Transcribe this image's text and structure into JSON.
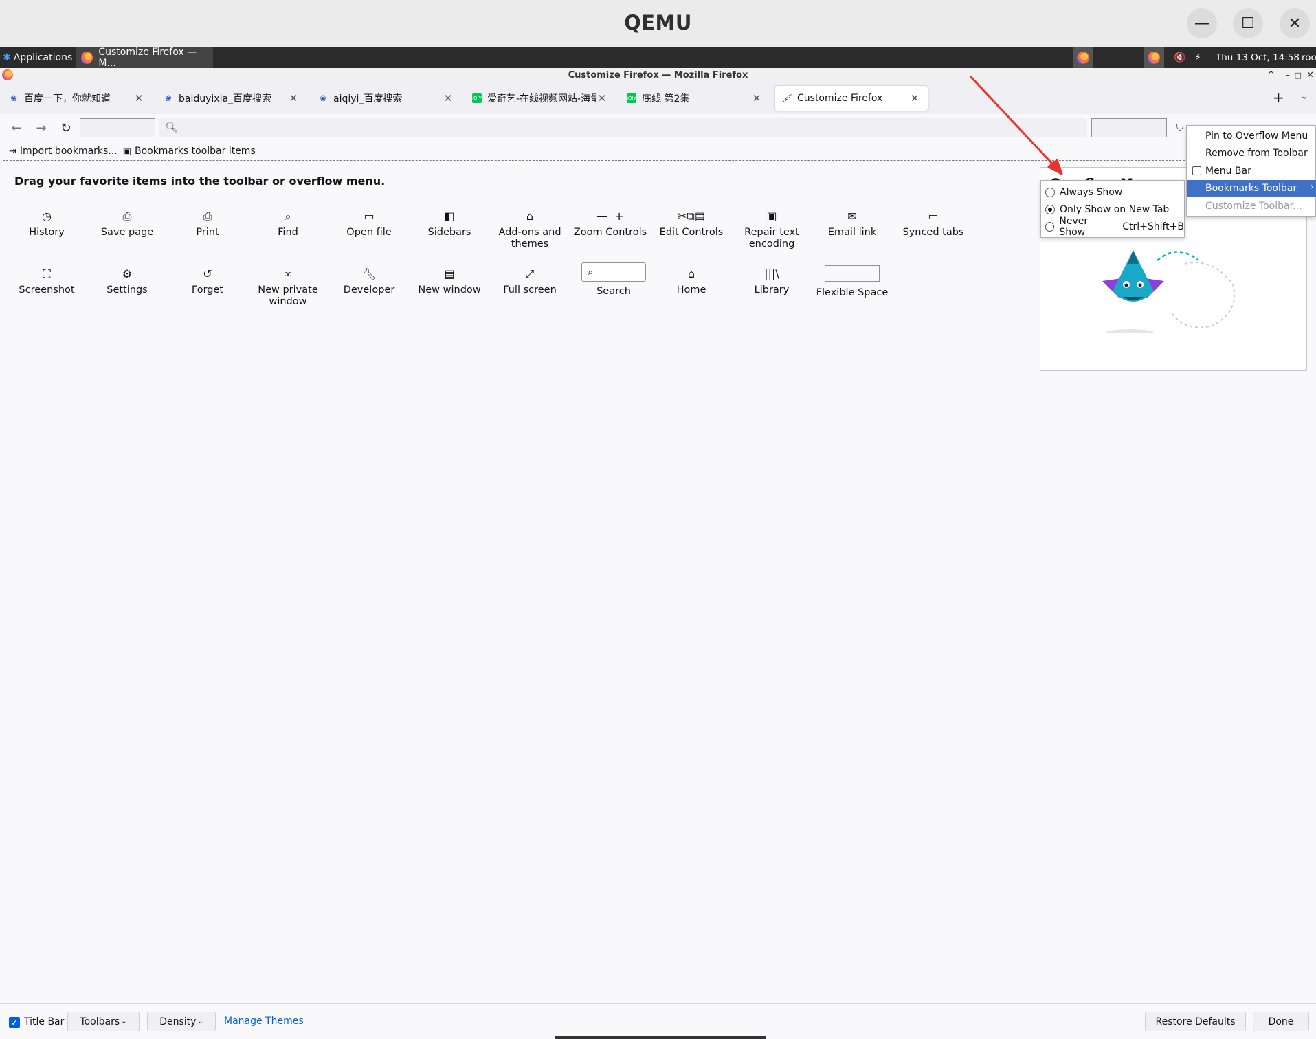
{
  "qemu": {
    "title": "QEMU",
    "minimize": "—",
    "maximize": "☐",
    "close": "✕"
  },
  "panel": {
    "applications": "Applications",
    "task": "Customize Firefox — M...",
    "clock": "Thu 13 Oct, 14:58",
    "user": "roo"
  },
  "firefox": {
    "window_title": "Customize Firefox — Mozilla Firefox"
  },
  "tabs": [
    {
      "label": "百度一下，你就知道",
      "icon": "baidu-paw"
    },
    {
      "label": "baiduyixia_百度搜索",
      "icon": "baidu-paw"
    },
    {
      "label": "aiqiyi_百度搜索",
      "icon": "baidu-paw"
    },
    {
      "label": "爱奇艺-在线视频网站-海量正",
      "icon": "iqiyi"
    },
    {
      "label": "底线 第2集",
      "icon": "iqiyi"
    },
    {
      "label": "Customize Firefox",
      "icon": "customize-brush"
    }
  ],
  "bookmarks": {
    "import": "Import bookmarks...",
    "toolbar_items": "Bookmarks toolbar items"
  },
  "palette": {
    "heading": "Drag your favorite items into the toolbar or overflow menu.",
    "row1": [
      {
        "label": "History",
        "icon": "clock"
      },
      {
        "label": "Save page",
        "icon": "save"
      },
      {
        "label": "Print",
        "icon": "printer"
      },
      {
        "label": "Find",
        "icon": "magnifier"
      },
      {
        "label": "Open file",
        "icon": "folder"
      },
      {
        "label": "Sidebars",
        "icon": "sidebar"
      },
      {
        "label": "Add-ons and themes",
        "icon": "puzzle"
      },
      {
        "label": "Zoom Controls",
        "icon": "zoom"
      },
      {
        "label": "Edit Controls",
        "icon": "cut-copy-paste"
      },
      {
        "label": "Repair text encoding",
        "icon": "text-encoding"
      },
      {
        "label": "Email link",
        "icon": "envelope"
      },
      {
        "label": "Synced tabs",
        "icon": "synced-tabs"
      }
    ],
    "row2": [
      {
        "label": "Screenshot",
        "icon": "screenshot"
      },
      {
        "label": "Settings",
        "icon": "gear"
      },
      {
        "label": "Forget",
        "icon": "forget"
      },
      {
        "label": "New private window",
        "icon": "mask"
      },
      {
        "label": "Developer",
        "icon": "wrench"
      },
      {
        "label": "New window",
        "icon": "window"
      },
      {
        "label": "Full screen",
        "icon": "expand"
      },
      {
        "label": "Search",
        "icon": "search-box"
      },
      {
        "label": "Home",
        "icon": "home"
      },
      {
        "label": "Library",
        "icon": "library"
      },
      {
        "label": "Flexible Space",
        "icon": "flex-space"
      }
    ]
  },
  "overflow_panel": {
    "title": "Overflow Menu"
  },
  "bookmarks_submenu": {
    "options": [
      {
        "label": "Always Show",
        "selected": false,
        "shortcut": ""
      },
      {
        "label": "Only Show on New Tab",
        "selected": true,
        "shortcut": ""
      },
      {
        "label": "Never Show",
        "selected": false,
        "shortcut": "Ctrl+Shift+B"
      }
    ]
  },
  "context_menu": {
    "items": [
      {
        "label": "Pin to Overflow Menu"
      },
      {
        "label": "Remove from Toolbar"
      },
      {
        "label": "Menu Bar",
        "checkbox": true
      },
      {
        "label": "Bookmarks Toolbar",
        "selected": true
      },
      {
        "label": "Customize Toolbar...",
        "disabled": true
      }
    ]
  },
  "bottom": {
    "title_bar": "Title Bar",
    "toolbars": "Toolbars",
    "density": "Density",
    "manage_themes": "Manage Themes",
    "restore_defaults": "Restore Defaults",
    "done": "Done"
  },
  "colors": {
    "accent": "#0061e0",
    "menu_selection": "#3f72c6",
    "arrow": "#e8342f"
  }
}
